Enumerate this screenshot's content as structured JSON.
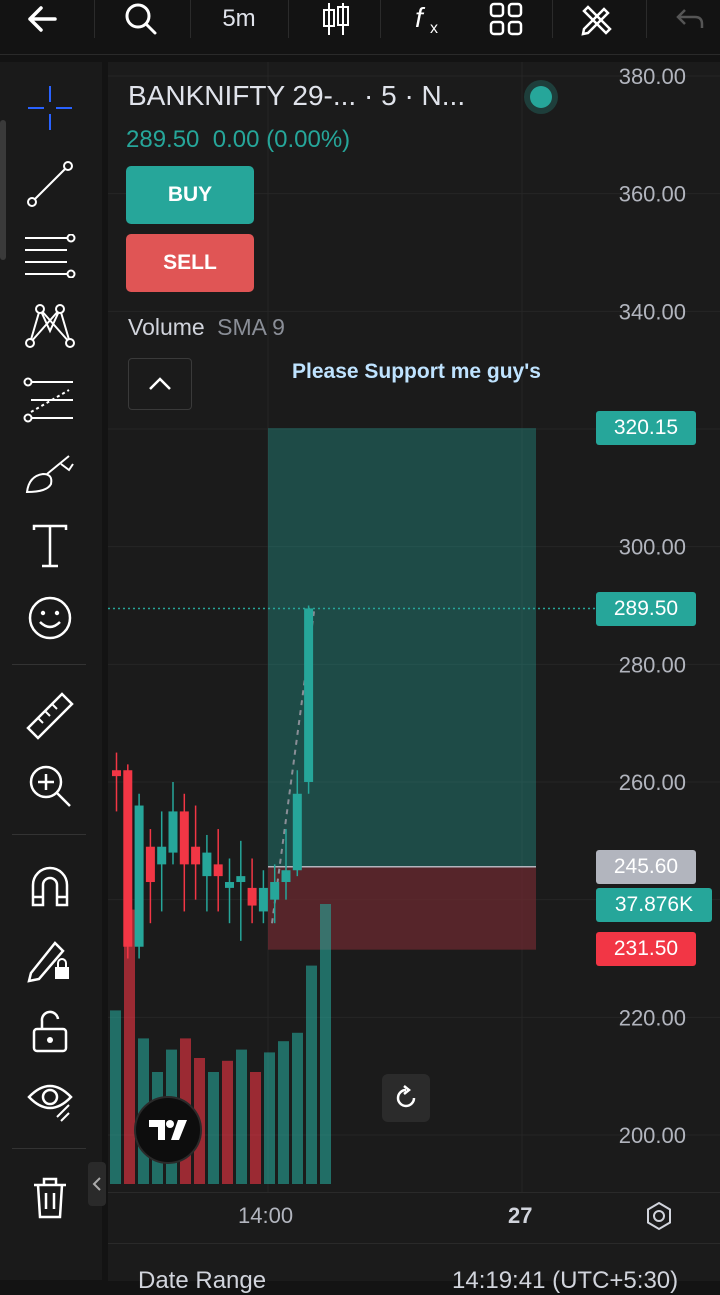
{
  "toolbar": {
    "interval": "5m",
    "icons": [
      "back-arrow-icon",
      "search-icon",
      "candles-icon",
      "indicators-fx-icon",
      "layouts-grid-icon",
      "drawing-pencil-ruler-icon",
      "undo-icon"
    ]
  },
  "left_tools": [
    "crosshair-icon",
    "trend-line-icon",
    "fib-icon",
    "pattern-icon",
    "projection-icon",
    "brush-icon",
    "text-icon",
    "emoji-icon",
    "ruler-icon",
    "zoom-in-icon",
    "magnet-icon",
    "lock-drawing-icon",
    "unlock-icon",
    "eye-icon",
    "trash-icon"
  ],
  "header": {
    "symbol": "BANKNIFTY 29-... · 5 · N...",
    "quote": "289.50  0.00 (0.00%)",
    "buy_label": "BUY",
    "sell_label": "SELL",
    "volume_label": "Volume",
    "volume_sma": "SMA 9",
    "annotation": "Please Support me guy's",
    "status_color": "#26a69a"
  },
  "colors": {
    "up": "#26a69a",
    "down": "#f23645",
    "buy_button": "#26a69a",
    "sell_button": "#e05555",
    "profit_zone": "#26a69a",
    "loss_zone": "#6b2a30"
  },
  "chart_data": {
    "type": "candlestick",
    "y_ticks": [
      "380.00",
      "360.00",
      "340.00",
      "300.00",
      "280.00",
      "260.00",
      "220.00",
      "200.00"
    ],
    "ylim": [
      192,
      382
    ],
    "x_ticks": [
      "14:00",
      "27"
    ],
    "candles": [
      {
        "o": 262,
        "h": 265,
        "l": 255,
        "c": 261
      },
      {
        "o": 262,
        "h": 263,
        "l": 230,
        "c": 232
      },
      {
        "o": 232,
        "h": 258,
        "l": 230,
        "c": 256
      },
      {
        "o": 249,
        "h": 252,
        "l": 236,
        "c": 243
      },
      {
        "o": 246,
        "h": 255,
        "l": 238,
        "c": 249
      },
      {
        "o": 248,
        "h": 260,
        "l": 246,
        "c": 255
      },
      {
        "o": 255,
        "h": 258,
        "l": 238,
        "c": 246
      },
      {
        "o": 249,
        "h": 256,
        "l": 240,
        "c": 246
      },
      {
        "o": 244,
        "h": 251,
        "l": 238,
        "c": 248
      },
      {
        "o": 246,
        "h": 252,
        "l": 238,
        "c": 244
      },
      {
        "o": 242,
        "h": 247,
        "l": 236,
        "c": 243
      },
      {
        "o": 243,
        "h": 250,
        "l": 233,
        "c": 244
      },
      {
        "o": 242,
        "h": 247,
        "l": 236,
        "c": 239
      },
      {
        "o": 238,
        "h": 245,
        "l": 236,
        "c": 242
      },
      {
        "o": 240,
        "h": 246,
        "l": 236,
        "c": 243
      },
      {
        "o": 243,
        "h": 252,
        "l": 240,
        "c": 245
      },
      {
        "o": 245,
        "h": 262,
        "l": 244,
        "c": 258
      },
      {
        "o": 260,
        "h": 290,
        "l": 258,
        "c": 289.5
      }
    ],
    "volume": [
      {
        "v": 0.62,
        "d": "up"
      },
      {
        "v": 0.98,
        "d": "down"
      },
      {
        "v": 0.52,
        "d": "up"
      },
      {
        "v": 0.4,
        "d": "up"
      },
      {
        "v": 0.48,
        "d": "up"
      },
      {
        "v": 0.52,
        "d": "down"
      },
      {
        "v": 0.45,
        "d": "down"
      },
      {
        "v": 0.4,
        "d": "up"
      },
      {
        "v": 0.44,
        "d": "down"
      },
      {
        "v": 0.48,
        "d": "up"
      },
      {
        "v": 0.4,
        "d": "down"
      },
      {
        "v": 0.47,
        "d": "up"
      },
      {
        "v": 0.51,
        "d": "up"
      },
      {
        "v": 0.54,
        "d": "up"
      },
      {
        "v": 0.78,
        "d": "up"
      },
      {
        "v": 1.0,
        "d": "up"
      }
    ],
    "position": {
      "target": "320.15",
      "entry": "245.60",
      "stop": "231.50",
      "last": "289.50",
      "volume_value": "37.876K",
      "target_v": 320.15,
      "entry_v": 245.6,
      "stop_v": 231.5,
      "last_v": 289.5
    }
  },
  "bottom": {
    "date_range": "Date Range",
    "clock": "14:19:41 (UTC+5:30)"
  }
}
